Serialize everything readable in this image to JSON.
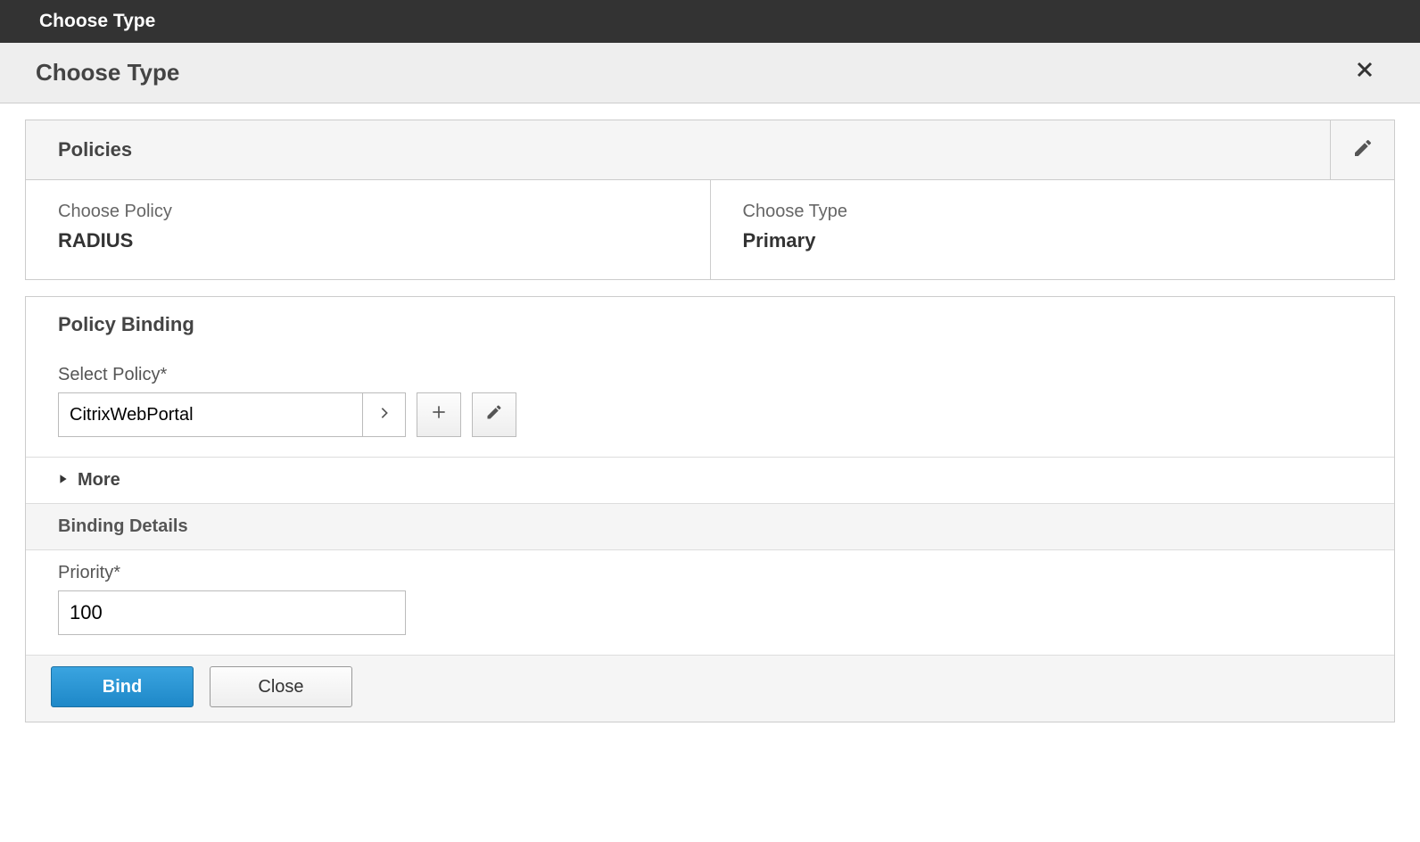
{
  "topbar": {
    "title": "Choose Type"
  },
  "subbar": {
    "title": "Choose Type"
  },
  "policies": {
    "header": "Policies",
    "choose_policy_label": "Choose Policy",
    "choose_policy_value": "RADIUS",
    "choose_type_label": "Choose Type",
    "choose_type_value": "Primary"
  },
  "binding": {
    "header": "Policy Binding",
    "select_policy_label": "Select Policy*",
    "select_policy_value": "CitrixWebPortal",
    "more_label": "More",
    "details_header": "Binding Details",
    "priority_label": "Priority*",
    "priority_value": "100"
  },
  "footer": {
    "bind": "Bind",
    "close": "Close"
  }
}
